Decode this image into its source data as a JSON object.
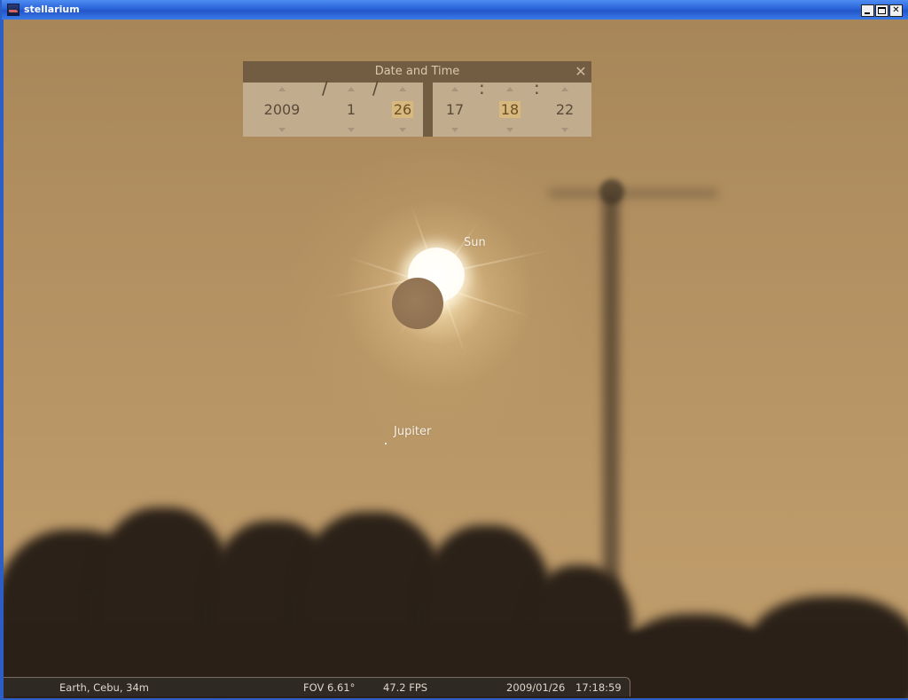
{
  "window": {
    "title": "stellarium"
  },
  "sky": {
    "labels": {
      "sun": "Sun",
      "jupiter": "Jupiter"
    }
  },
  "date_time_dialog": {
    "title": "Date and Time",
    "close_glyph": "✕",
    "date": {
      "year": "2009",
      "month": "1",
      "day": "26",
      "separator": "/"
    },
    "time": {
      "hour": "17",
      "minute": "18",
      "second": "22",
      "separator": ":"
    }
  },
  "status_bar": {
    "location": "Earth, Cebu, 34m",
    "fov": "FOV 6.61°",
    "fps": "47.2 FPS",
    "date": "2009/01/26",
    "time": "17:18:59"
  },
  "icons": {
    "app": "stellarium-app-icon",
    "minimize": "minimize-icon",
    "maximize": "maximize-icon",
    "close": "close-icon"
  }
}
